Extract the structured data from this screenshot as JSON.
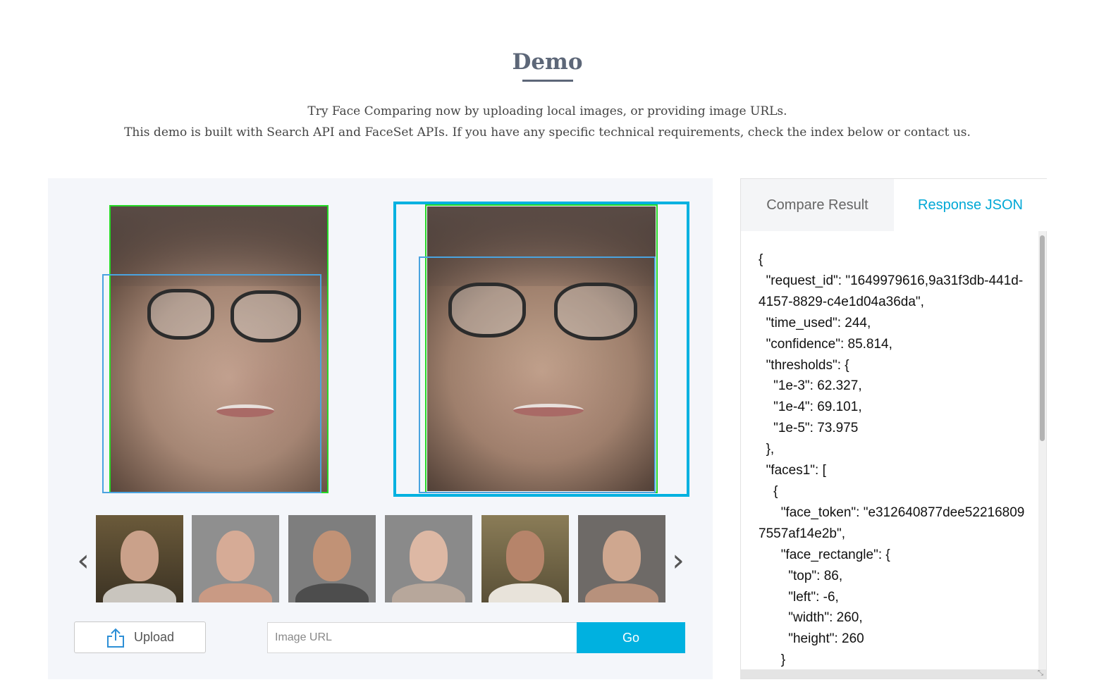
{
  "header": {
    "title": "Demo",
    "description_line1": "Try Face Comparing now by uploading local images, or providing image URLs.",
    "description_line2": "This demo is built with Search API and FaceSet APIs. If you have any specific technical requirements, check the index below or contact us."
  },
  "demo": {
    "upload_label": "Upload",
    "url_placeholder": "Image URL",
    "go_label": "Go",
    "gallery_count": 6,
    "selected_image": "right"
  },
  "result": {
    "tabs": [
      {
        "label": "Compare Result",
        "active": false
      },
      {
        "label": "Response JSON",
        "active": true
      }
    ],
    "json_text": "{\n  \"request_id\": \"1649979616,9a31f3db-441d-4157-8829-c4e1d04a36da\",\n  \"time_used\": 244,\n  \"confidence\": 85.814,\n  \"thresholds\": {\n    \"1e-3\": 62.327,\n    \"1e-4\": 69.101,\n    \"1e-5\": 73.975\n  },\n  \"faces1\": [\n    {\n      \"face_token\": \"e312640877dee522168097557af14e2b\",\n      \"face_rectangle\": {\n        \"top\": 86,\n        \"left\": -6,\n        \"width\": 260,\n        \"height\": 260\n      }"
  },
  "colors": {
    "accent": "#00b1e0",
    "title": "#5d6778",
    "face_box_green": "#27d927",
    "face_box_blue": "#4aa3df"
  }
}
